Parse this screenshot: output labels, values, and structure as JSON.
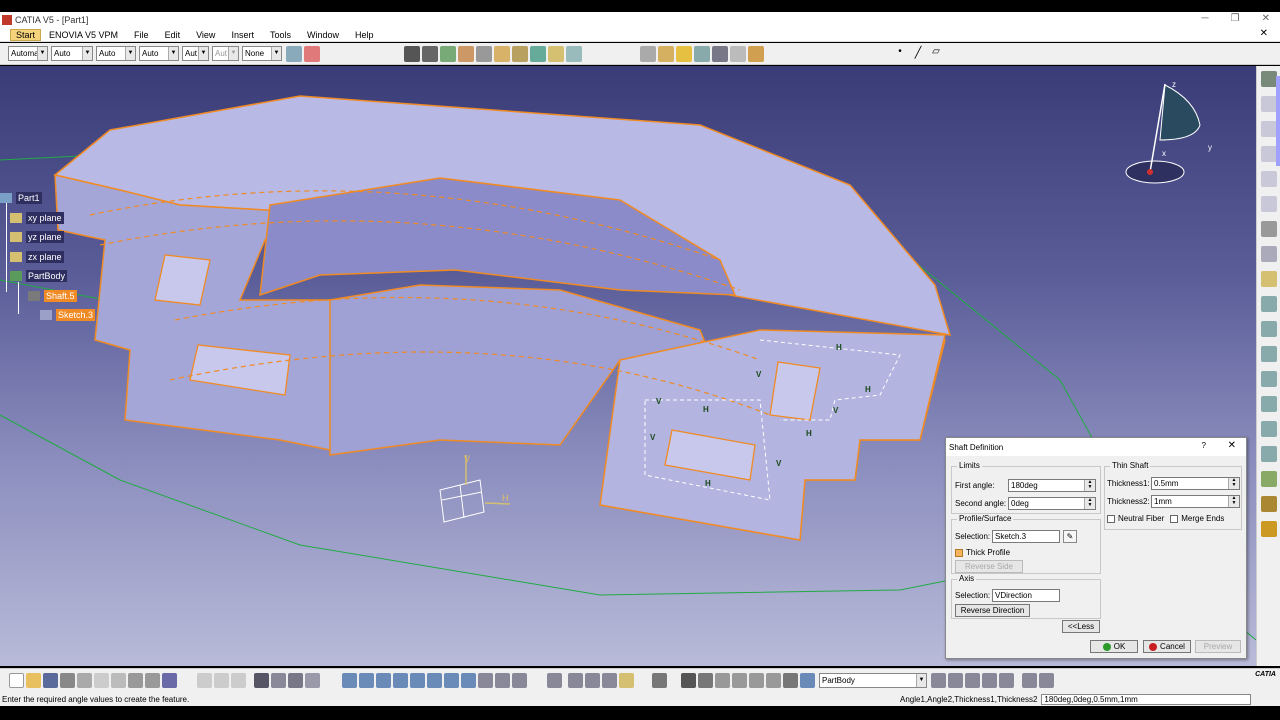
{
  "window": {
    "title": "CATIA V5 - [Part1]"
  },
  "menu": {
    "items": [
      "Start",
      "ENOVIA V5 VPM",
      "File",
      "Edit",
      "View",
      "Insert",
      "Tools",
      "Window",
      "Help"
    ]
  },
  "toolbar": {
    "combos": [
      "Automa",
      "Auto",
      "Auto",
      "Auto",
      "Aut",
      "Aut",
      "None"
    ]
  },
  "tree": {
    "root": "Part1",
    "xy": "xy plane",
    "yz": "yz plane",
    "zx": "zx plane",
    "body": "PartBody",
    "shaft": "Shaft.5",
    "sketch": "Sketch.3"
  },
  "compass": {
    "x": "x",
    "y": "y",
    "z": "z"
  },
  "labels": {
    "v": "V",
    "h": "H"
  },
  "dialog": {
    "title": "Shaft Definition",
    "help": "?",
    "close": "✕",
    "limits": {
      "title": "Limits",
      "first_label": "First angle:",
      "first_value": "180deg",
      "second_label": "Second angle:",
      "second_value": "0deg"
    },
    "thin": {
      "title": "Thin Shaft",
      "t1_label": "Thickness1:",
      "t1_value": "0.5mm",
      "t2_label": "Thickness2:",
      "t2_value": "1mm",
      "neutral": "Neutral Fiber",
      "merge": "Merge Ends"
    },
    "profile": {
      "title": "Profile/Surface",
      "sel_label": "Selection:",
      "sel_value": "Sketch.3",
      "thick": "Thick Profile",
      "reverse_side": "Reverse Side"
    },
    "axis": {
      "title": "Axis",
      "sel_label": "Selection:",
      "sel_value": "VDirection",
      "reverse_dir": "Reverse Direction"
    },
    "less": "<<Less",
    "ok": "OK",
    "cancel": "Cancel",
    "preview": "Preview"
  },
  "bottom": {
    "body_combo": "PartBody"
  },
  "status": {
    "message": "Enter the required angle values to create the feature.",
    "param_label": "Angle1,Angle2,Thickness1,Thickness2",
    "param_value": "180deg,0deg,0.5mm,1mm"
  },
  "brand": "CATIA"
}
